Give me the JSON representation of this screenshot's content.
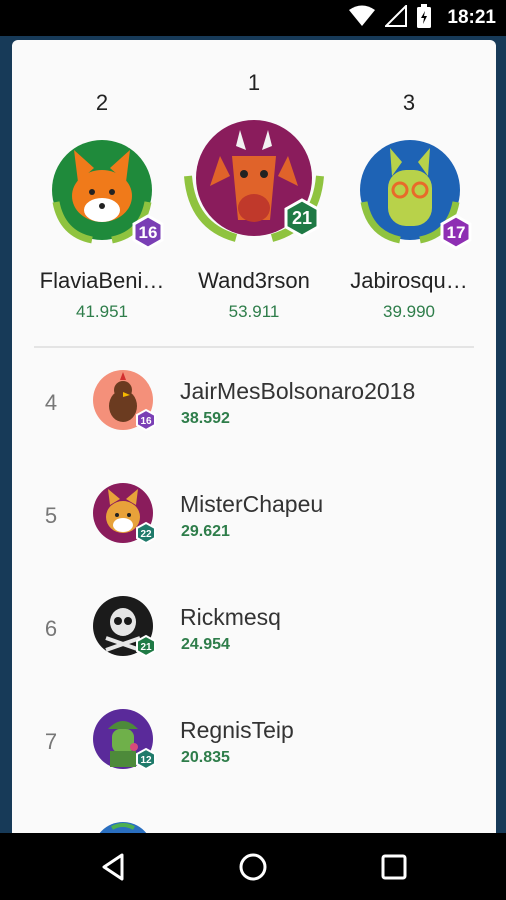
{
  "status_bar": {
    "time": "18:21"
  },
  "podium": [
    {
      "rank": "1",
      "name": "Wand3rson",
      "score": "53.911",
      "level": "21",
      "avatar": "dragon-avatar"
    },
    {
      "rank": "2",
      "name": "FlaviaBeni…",
      "score": "41.951",
      "level": "16",
      "avatar": "fox-avatar"
    },
    {
      "rank": "3",
      "name": "Jabirosqu…",
      "score": "39.990",
      "level": "17",
      "avatar": "llama-avatar"
    }
  ],
  "leaderboard": [
    {
      "rank": "4",
      "name": "JairMesBolsonaro2018",
      "score": "38.592",
      "level": "16",
      "avatar": "rooster-avatar"
    },
    {
      "rank": "5",
      "name": "MisterChapeu",
      "score": "29.621",
      "level": "22",
      "avatar": "shiba-avatar"
    },
    {
      "rank": "6",
      "name": "Rickmesq",
      "score": "24.954",
      "level": "21",
      "avatar": "skull-avatar"
    },
    {
      "rank": "7",
      "name": "RegnisTeip",
      "score": "20.835",
      "level": "12",
      "avatar": "soldier-avatar"
    }
  ],
  "colors": {
    "score": "#2e7d4a",
    "background": "#173a58",
    "badge_purple": "#7a3fb5",
    "badge_green": "#1f7a45"
  },
  "icons": [
    "wifi-icon",
    "signal-icon",
    "battery-icon",
    "back-icon",
    "home-icon",
    "recents-icon"
  ]
}
